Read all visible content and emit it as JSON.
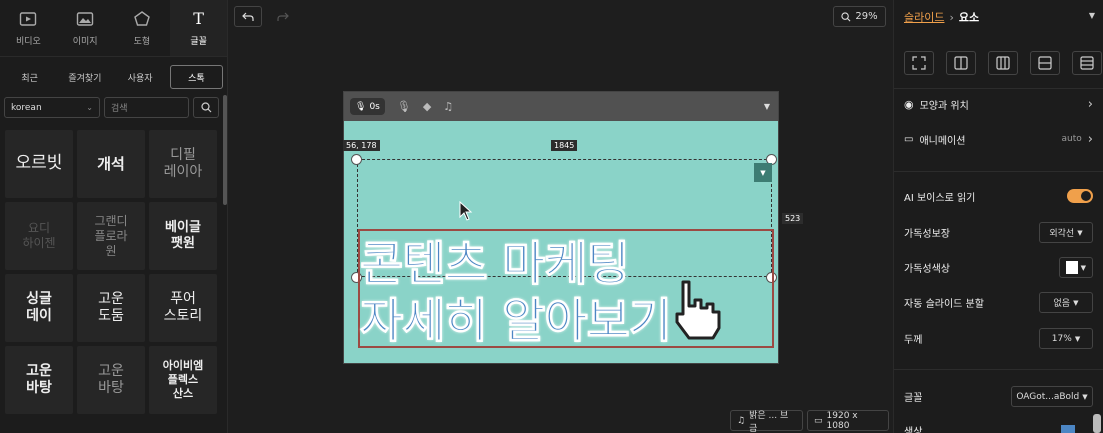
{
  "tools": [
    {
      "label": "비디오",
      "icon": "video-icon"
    },
    {
      "label": "이미지",
      "icon": "image-icon"
    },
    {
      "label": "도형",
      "icon": "shape-icon"
    },
    {
      "label": "글꼴",
      "icon": "text-icon"
    }
  ],
  "tabs": [
    "최근",
    "즐겨찾기",
    "사용자",
    "스톡"
  ],
  "font_filter": {
    "selected": "korean",
    "search_placeholder": "검색"
  },
  "font_samples": [
    "오르빗",
    "개석",
    "디필\n레이아",
    "요디\n하이젠",
    "그랜디\n플로라\n원",
    "베이글\n팻원",
    "싱글\n데이",
    "고운\n도둠",
    "푸어\n스토리",
    "고운\n바탕",
    "고운\n바탕",
    "아이비엠\n플렉스\n산스"
  ],
  "toolbar": {
    "zoom": "29%"
  },
  "slide": {
    "timer": "0s",
    "coord_label": "56, 178",
    "width_label": "1845",
    "height_label": "523",
    "headline_line1": "콘텐츠 마케팅",
    "headline_line2": "자세히 알아보기"
  },
  "bottom": {
    "music": "밝은 ... 브금",
    "resolution": "1920 x 1080"
  },
  "inspector": {
    "breadcrumb_link": "슬라이드",
    "breadcrumb_current": "요소",
    "shape_position": "모양과 위치",
    "animation": "애니메이션",
    "animation_value": "auto",
    "ai_voice": "AI 보이스로 읽기",
    "legibility": "가독성보장",
    "legibility_value": "외각선",
    "legibility_color": "가독성색상",
    "auto_split": "자동 슬라이드 분할",
    "auto_split_value": "없음",
    "thickness": "두께",
    "thickness_value": "17%",
    "font": "글꼴",
    "font_value": "OAGot...aBold",
    "color_label": "색상"
  },
  "colors": {
    "accent": "#f0a04b",
    "canvas_bg": "#8ad3c8",
    "headline": "#4c86c4"
  }
}
